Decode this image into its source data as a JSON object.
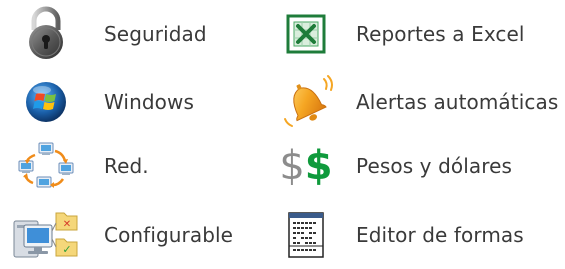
{
  "features": {
    "security": {
      "label": "Seguridad",
      "icon": "padlock-icon"
    },
    "windows": {
      "label": "Windows",
      "icon": "windows-logo-icon"
    },
    "network": {
      "label": "Red.",
      "icon": "network-icon"
    },
    "configurable": {
      "label": "Configurable",
      "icon": "configuration-icon"
    },
    "excel": {
      "label": "Reportes a Excel",
      "icon": "excel-icon"
    },
    "alerts": {
      "label": "Alertas automáticas",
      "icon": "bell-icon"
    },
    "currency": {
      "label": "Pesos y dólares",
      "icon": "dollar-icon"
    },
    "forms": {
      "label": "Editor de formas",
      "icon": "form-editor-icon"
    }
  },
  "colors": {
    "text": "#3a3a3a",
    "excel_green": "#1e7c3a",
    "dollar_gray": "#8c8c8c",
    "dollar_green": "#0f9a3c",
    "bell_orange": "#f5a623"
  }
}
